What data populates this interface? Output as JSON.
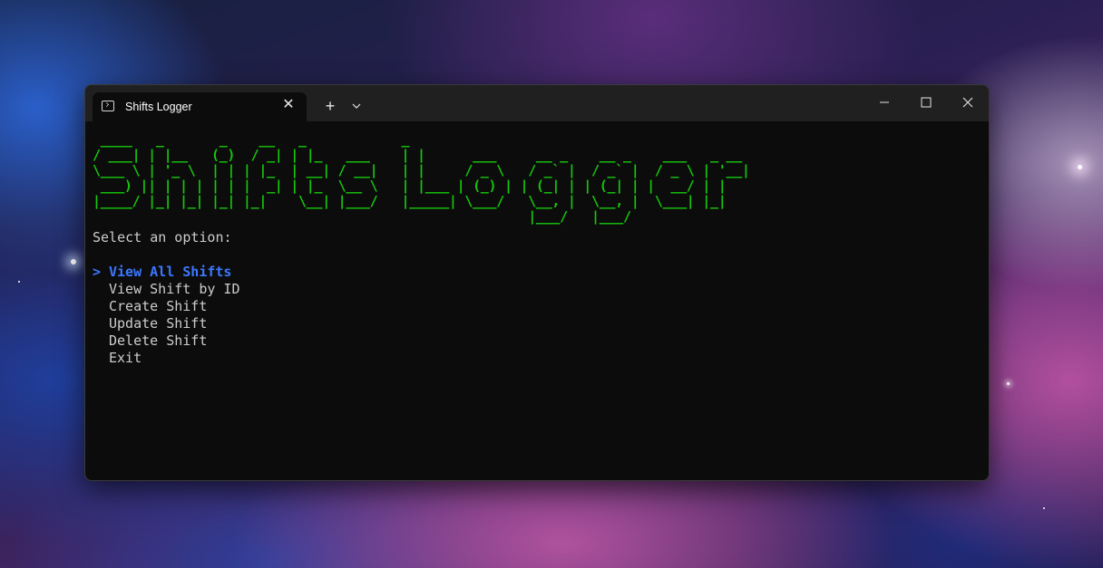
{
  "window": {
    "tab_title": "Shifts Logger",
    "tab_close": "✕",
    "new_tab": "+",
    "icons": {
      "tab": "terminal-icon",
      "dropdown": "chevron-down-icon",
      "minimize": "minimize-icon",
      "maximize": "maximize-icon",
      "close": "close-icon"
    }
  },
  "console": {
    "banner": " ____   _       _    __   _            _\n/ ___| | |__   (_)  / _| | |_   ___    | |      ___     __ _    __ _    ___   _ __\n\\___ \\ | '_ \\  | | | |_  | __| / __|   | |     / _ \\   / _` |  / _` |  / _ \\ | '__|\n ___) || | | | | | |  _| | |_  \\__ \\   | |___ | (_) | | (_| | | (_| | |  __/ | |\n|____/ |_| |_| |_| |_|    \\__| |___/   |_____| \\___/   \\__, |  \\__, |  \\___| |_|\n                                                       |___/   |___/",
    "prompt": "Select an option:",
    "selection_marker": ">",
    "selected_index": 0,
    "colors": {
      "banner": "#16c60c",
      "selected": "#3b78ff",
      "text": "#cccccc"
    },
    "options": [
      {
        "label": "View All Shifts"
      },
      {
        "label": "View Shift by ID"
      },
      {
        "label": "Create Shift"
      },
      {
        "label": "Update Shift"
      },
      {
        "label": "Delete Shift"
      },
      {
        "label": "Exit"
      }
    ]
  }
}
